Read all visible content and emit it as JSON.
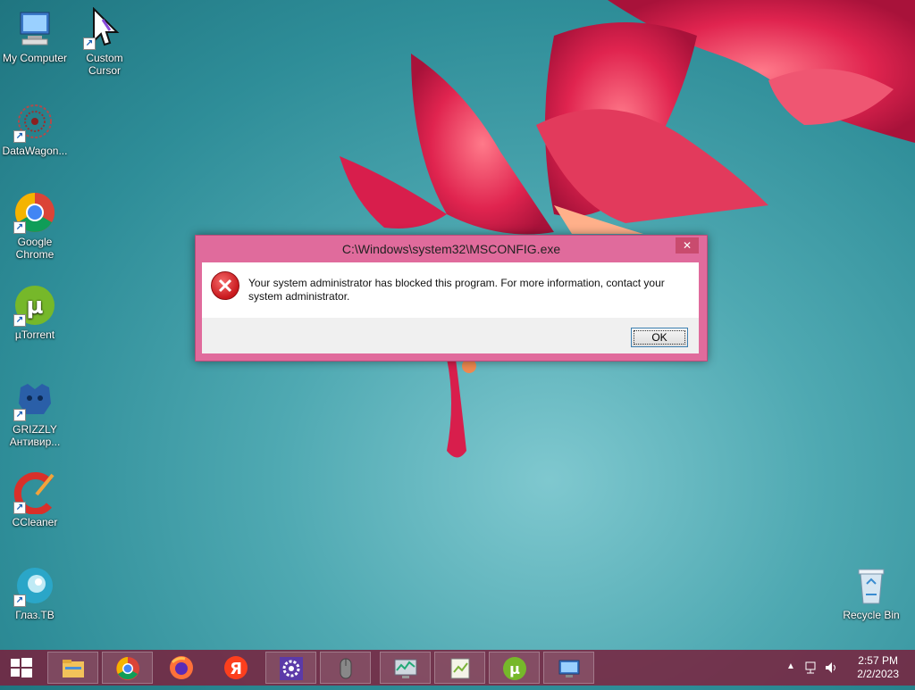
{
  "desktop": {
    "icons": [
      {
        "id": "my-computer",
        "label": "My Computer",
        "icon": "computer-icon"
      },
      {
        "id": "custom-cursor",
        "label": "Custom Cursor",
        "icon": "cursor-icon"
      },
      {
        "id": "datawagon",
        "label": "DataWagon...",
        "icon": "datawagon-icon"
      },
      {
        "id": "google-chrome",
        "label": "Google Chrome",
        "icon": "chrome-icon"
      },
      {
        "id": "utorrent",
        "label": "µTorrent",
        "icon": "utorrent-icon"
      },
      {
        "id": "grizzly",
        "label": "GRIZZLY Антивир...",
        "icon": "grizzly-icon"
      },
      {
        "id": "ccleaner",
        "label": "CCleaner",
        "icon": "ccleaner-icon"
      },
      {
        "id": "glaz-tv",
        "label": "Глаз.ТВ",
        "icon": "glaz-tv-icon"
      },
      {
        "id": "recycle-bin",
        "label": "Recycle Bin",
        "icon": "recycle-bin-icon"
      }
    ]
  },
  "dialog": {
    "title": "C:\\Windows\\system32\\MSCONFIG.exe",
    "close_label": "✕",
    "message": "Your system administrator has blocked this program. For more information, contact your system administrator.",
    "ok_label": "OK",
    "accent_color": "#e06b9c"
  },
  "taskbar": {
    "pinned": [
      "file-explorer-icon",
      "chrome-icon",
      "firefox-icon",
      "yandex-icon",
      "settings-gear-icon",
      "mouse-icon",
      "system-monitor-icon",
      "notepad-plus-icon",
      "utorrent-icon",
      "remote-desktop-icon"
    ],
    "tray": {
      "time": "2:57 PM",
      "date": "2/2/2023"
    },
    "color": "#7a203c"
  }
}
